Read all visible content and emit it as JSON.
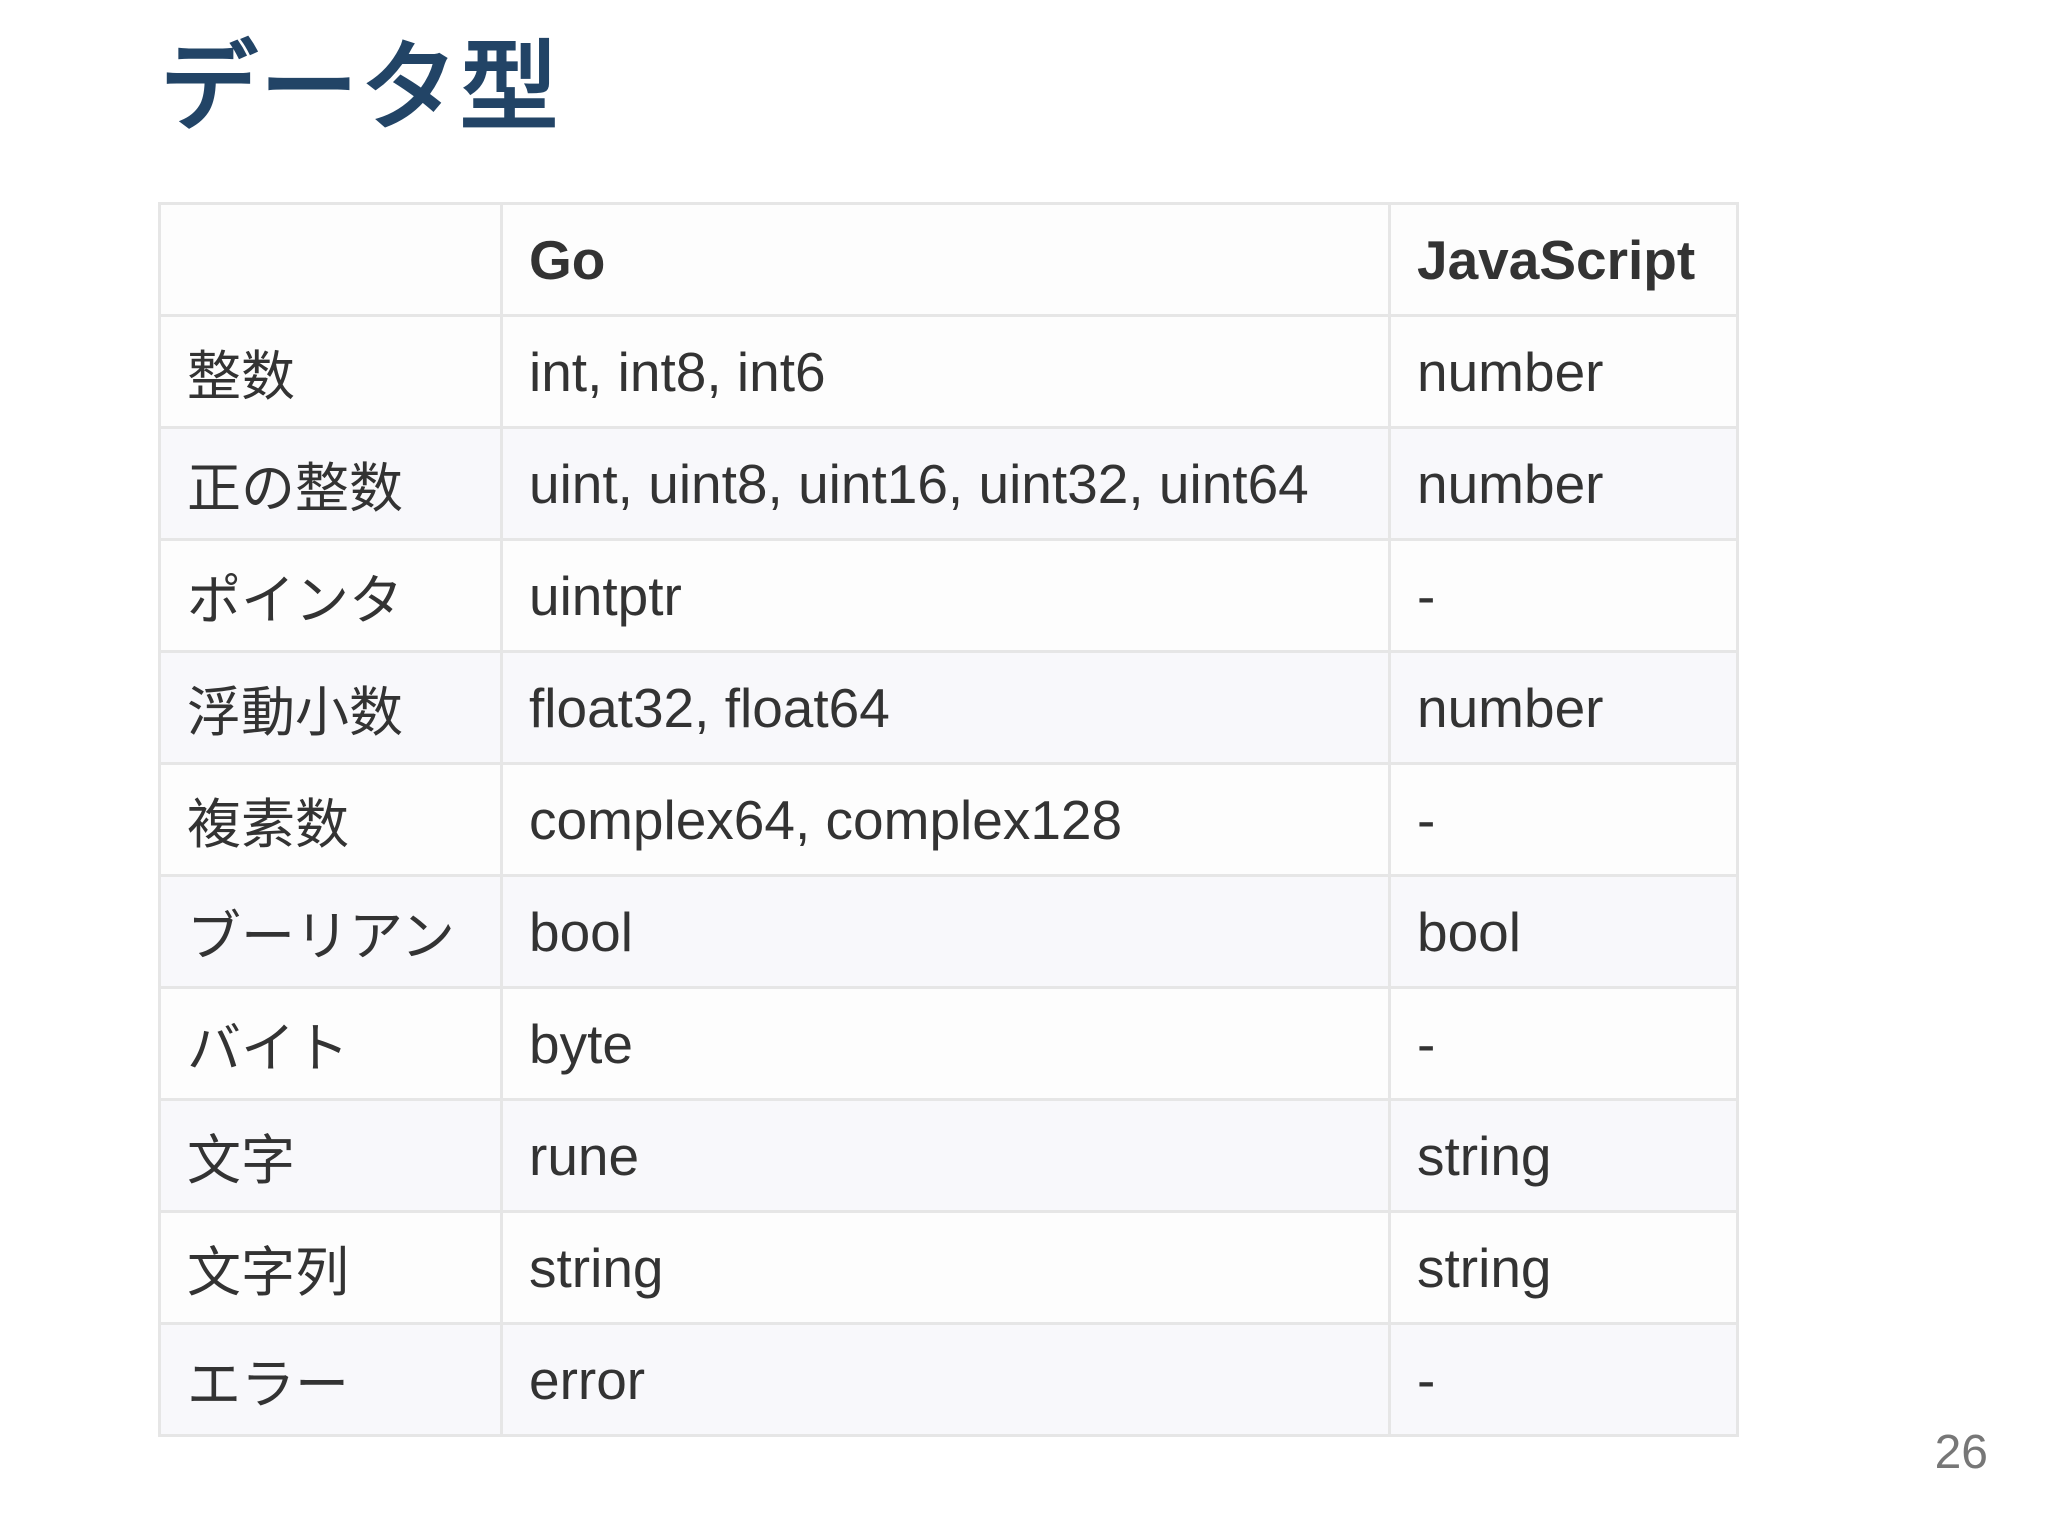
{
  "title": "データ型",
  "table": {
    "headers": [
      "",
      "Go",
      "JavaScript"
    ],
    "rows": [
      [
        "整数",
        "int, int8, int6",
        "number"
      ],
      [
        "正の整数",
        "uint, uint8, uint16, uint32, uint64",
        "number"
      ],
      [
        "ポインタ",
        "uintptr",
        "-"
      ],
      [
        "浮動小数",
        "float32, float64",
        "number"
      ],
      [
        "複素数",
        "complex64, complex128",
        "-"
      ],
      [
        "ブーリアン",
        "bool",
        "bool"
      ],
      [
        "バイト",
        "byte",
        "-"
      ],
      [
        "文字",
        "rune",
        "string"
      ],
      [
        "文字列",
        "string",
        "string"
      ],
      [
        "エラー",
        "error",
        "-"
      ]
    ]
  },
  "page_number": "26"
}
